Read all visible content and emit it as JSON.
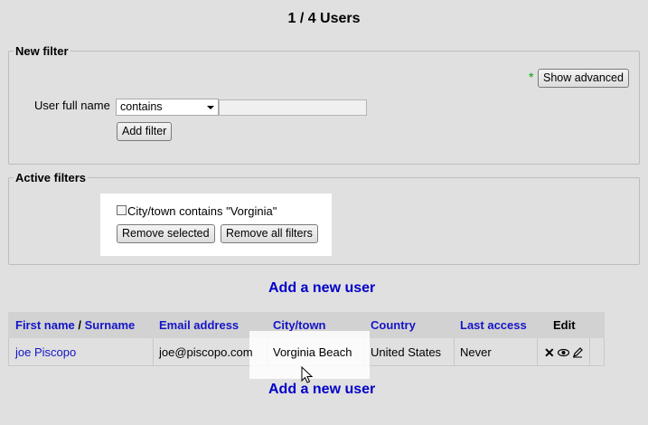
{
  "page": {
    "title": "1 / 4 Users"
  },
  "new_filter": {
    "legend": "New filter",
    "advanced_star": "*",
    "show_advanced_label": "Show advanced",
    "field_label": "User full name",
    "operator_value": "contains",
    "text_value": "",
    "add_filter_label": "Add filter"
  },
  "active_filters": {
    "legend": "Active filters",
    "filter_text": "City/town contains \"Vorginia\"",
    "filter_checked": false,
    "remove_selected_label": "Remove selected",
    "remove_all_label": "Remove all filters"
  },
  "add_user_label": "Add a new user",
  "table": {
    "headers": {
      "first_name": "First name",
      "separator": "/",
      "surname": "Surname",
      "email": "Email address",
      "city": "City/town",
      "country": "Country",
      "last_access": "Last access",
      "edit": "Edit"
    },
    "rows": [
      {
        "name": "joe Piscopo",
        "email": "joe@piscopo.com",
        "city": "Vorginia Beach",
        "country": "United States",
        "last_access": "Never",
        "edit_icons": [
          "delete-icon",
          "view-icon",
          "edit-icon"
        ]
      }
    ]
  },
  "colors": {
    "link": "#0000c8",
    "header_bg": "#d2d2d2",
    "page_bg": "#e0e0e0",
    "star": "#00a000"
  }
}
